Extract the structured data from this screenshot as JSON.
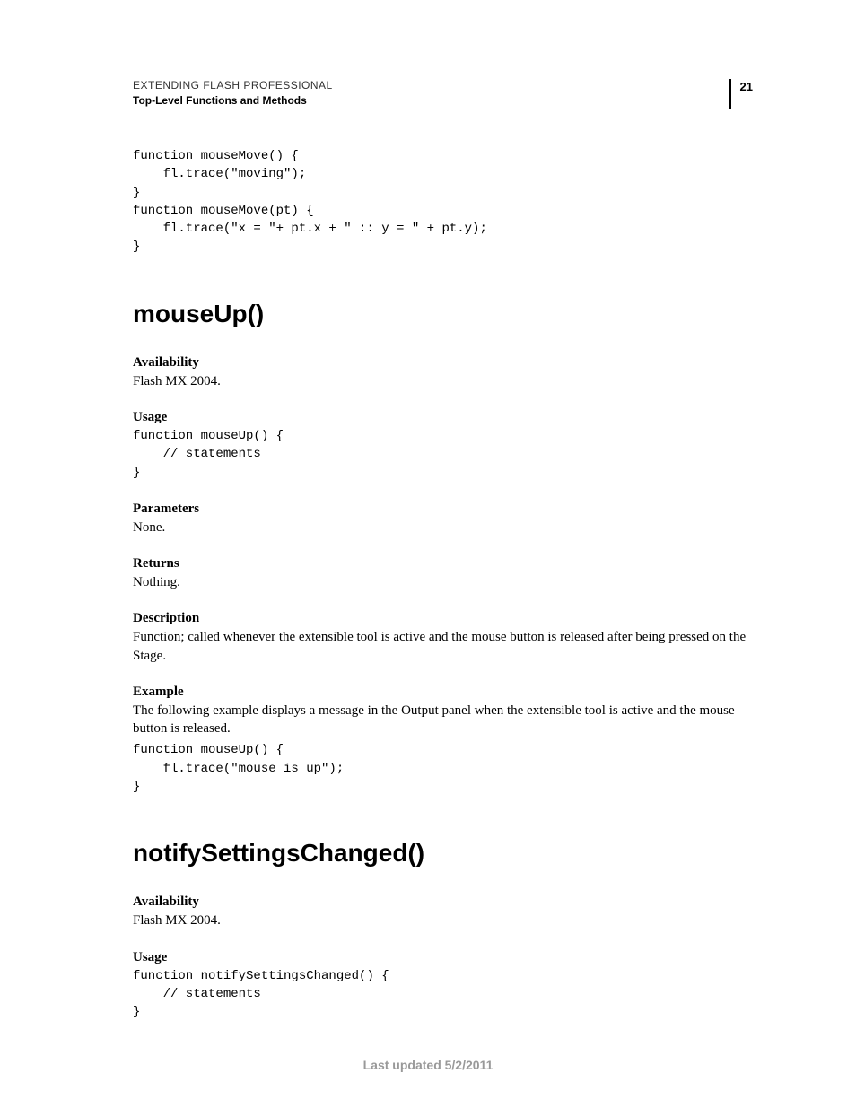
{
  "header": {
    "title": "EXTENDING FLASH PROFESSIONAL",
    "subtitle": "Top-Level Functions and Methods",
    "page_number": "21"
  },
  "top_code": "function mouseMove() { \n    fl.trace(\"moving\"); \n} \nfunction mouseMove(pt) { \n    fl.trace(\"x = \"+ pt.x + \" :: y = \" + pt.y); \n}",
  "section1": {
    "title": "mouseUp()",
    "availability_label": "Availability",
    "availability_text": "Flash MX 2004.",
    "usage_label": "Usage",
    "usage_code": "function mouseUp() { \n    // statements \n}",
    "parameters_label": "Parameters",
    "parameters_text": "None.",
    "returns_label": "Returns",
    "returns_text": "Nothing.",
    "description_label": "Description",
    "description_text": "Function; called whenever the extensible tool is active and the mouse button is released after being pressed on the Stage.",
    "example_label": "Example",
    "example_text": "The following example displays a message in the Output panel when the extensible tool is active and the mouse button is released.",
    "example_code": "function mouseUp() { \n    fl.trace(\"mouse is up\"); \n}"
  },
  "section2": {
    "title": "notifySettingsChanged()",
    "availability_label": "Availability",
    "availability_text": "Flash MX 2004.",
    "usage_label": "Usage",
    "usage_code": "function notifySettingsChanged() { \n    // statements \n}"
  },
  "footer": "Last updated 5/2/2011"
}
